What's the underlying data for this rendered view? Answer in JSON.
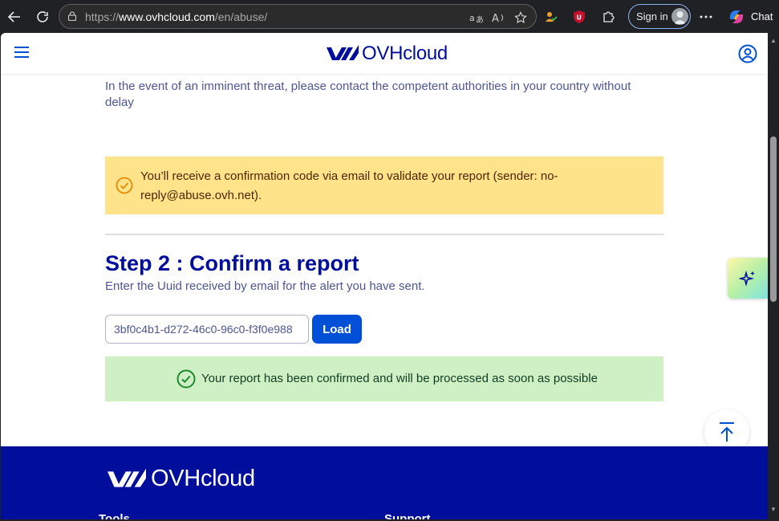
{
  "browser": {
    "url_prefix": "https://",
    "url_host": "www.ovhcloud.com",
    "url_path": "/en/abuse/",
    "signin_label": "Sign in",
    "chat_label": "Chat"
  },
  "header": {
    "logo_text": "OVHcloud"
  },
  "content": {
    "threat_text": "In the event of an imminent threat, please contact the competent authorities in your country without delay",
    "warning_text": "You’ll receive a confirmation code via email to validate your report (sender: no-reply@abuse.ovh.net).",
    "step_title": "Step 2 : Confirm a report",
    "step_subtitle": "Enter the Uuid received by email for the alert you have sent.",
    "uuid_value": "3bf0c4b1-d272-46c0-96c0-f3f0e988",
    "load_label": "Load",
    "success_text": "Your report has been confirmed and will be processed as soon as possible"
  },
  "footer": {
    "logo_text": "OVHcloud",
    "col1": "Tools",
    "col2": "Support"
  },
  "colors": {
    "brand": "#000e9c",
    "primary": "#0050d7",
    "warning_bg": "#ffe38a",
    "success_bg": "#cff0c4"
  }
}
